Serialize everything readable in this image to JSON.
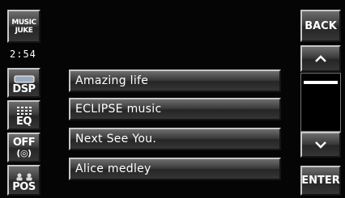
{
  "header": {
    "logo_line1": "MUSIC",
    "logo_line2": "JUKE"
  },
  "clock": "2:54",
  "sidebar": {
    "dsp": "DSP",
    "eq": "EQ",
    "off_line1": "OFF",
    "off_line2": "(◎)",
    "pos": "POS"
  },
  "tracks": [
    {
      "title": "Amazing life"
    },
    {
      "title": "ECLIPSE music"
    },
    {
      "title": "Next See You."
    },
    {
      "title": "Alice medley"
    }
  ],
  "nav": {
    "back": "BACK",
    "enter": "ENTER",
    "up_icon": "chevron-up-icon",
    "down_icon": "chevron-down-icon"
  },
  "colors": {
    "background": "#050505",
    "button_top": "#6e6e6e",
    "button_bottom": "#262626",
    "text": "#ffffff"
  }
}
